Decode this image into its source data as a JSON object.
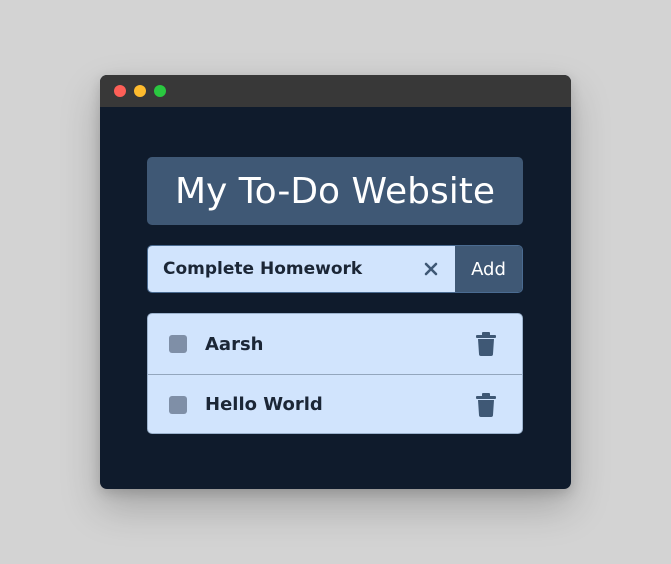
{
  "window": {
    "controls": [
      "close",
      "minimize",
      "maximize"
    ]
  },
  "app": {
    "title": "My To-Do Website"
  },
  "input": {
    "value": "Complete Homework",
    "clear_icon": "close-icon",
    "add_label": "Add"
  },
  "todos": [
    {
      "label": "Aarsh",
      "checked": false,
      "delete_icon": "trash-icon"
    },
    {
      "label": "Hello World",
      "checked": false,
      "delete_icon": "trash-icon"
    }
  ],
  "colors": {
    "background": "#d3d3d3",
    "window_bg": "#0f1b2c",
    "titlebar": "#383838",
    "accent": "#3f5875",
    "field_bg": "#d1e4fd",
    "text": "#1b2636"
  }
}
